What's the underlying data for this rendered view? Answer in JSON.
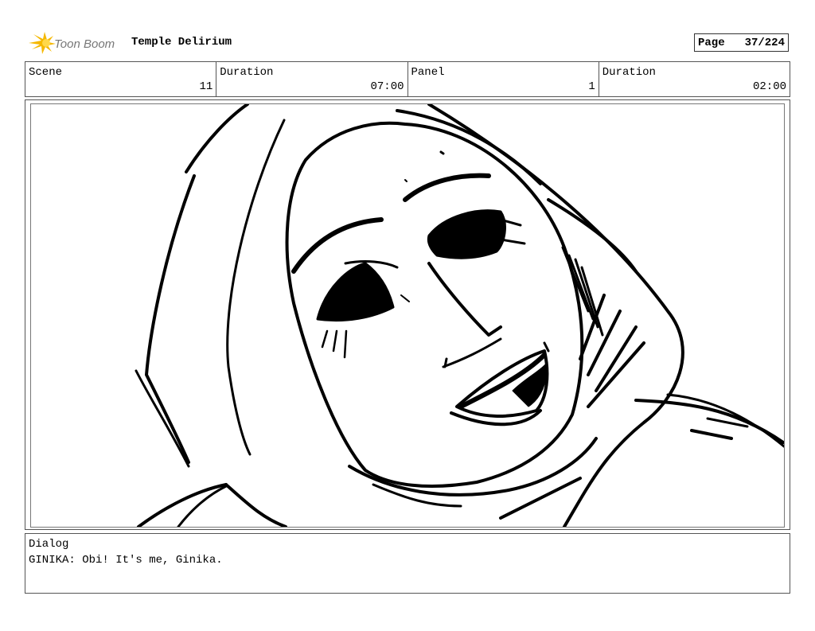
{
  "header": {
    "logo_text": "Toon Boom",
    "logo_icon": "toon-boom-starburst-icon",
    "logo_color": "#F5B800",
    "project_title": "Temple Delirium",
    "page_label": "Page",
    "page_number": "37/224"
  },
  "info": [
    {
      "label": "Scene",
      "value": "11"
    },
    {
      "label": "Duration",
      "value": "07:00"
    },
    {
      "label": "Panel",
      "value": "1"
    },
    {
      "label": "Duration",
      "value": "02:00"
    }
  ],
  "panel": {
    "image": "storyboard-sketch-ginika-face"
  },
  "dialog": {
    "label": "Dialog",
    "text": "GINIKA: Obi! It's me, Ginika."
  }
}
